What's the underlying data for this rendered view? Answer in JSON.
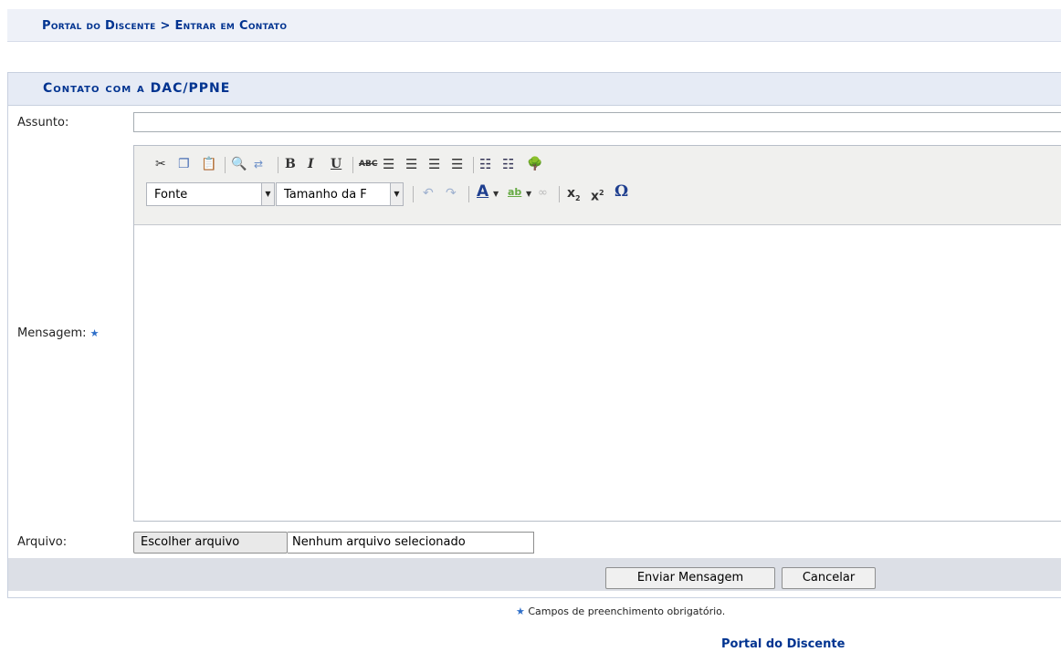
{
  "breadcrumb": "Portal do Discente > Entrar em Contato",
  "form": {
    "title": "Contato com a DAC/PPNE",
    "assunto_label": "Assunto:",
    "assunto_value": "",
    "mensagem_label": "Mensagem:",
    "arquivo_label": "Arquivo:",
    "file_button": "Escolher arquivo",
    "file_status": "Nenhum arquivo selecionado"
  },
  "editor": {
    "font_select": "Fonte",
    "size_select": "Tamanho da F",
    "toolbar_row1": [
      "cut-icon",
      "copy-icon",
      "paste-icon",
      "find-icon",
      "replace-icon",
      "bold-icon",
      "italic-icon",
      "underline-icon",
      "strikethrough-icon",
      "align-left-icon",
      "align-center-icon",
      "align-right-icon",
      "align-justify-icon",
      "bullet-list-icon",
      "numbered-list-icon",
      "image-icon"
    ],
    "toolbar_row2": [
      "undo-icon",
      "redo-icon",
      "text-color-icon",
      "highlight-color-icon",
      "link-icon",
      "subscript-icon",
      "superscript-icon",
      "special-char-icon"
    ]
  },
  "actions": {
    "send": "Enviar Mensagem",
    "cancel": "Cancelar"
  },
  "required_note": "Campos de preenchimento obrigatório.",
  "footer_link": "Portal do Discente",
  "colors": {
    "brand": "#003390",
    "required_star": "#2f6fc9",
    "header_bg": "#e6ebf5",
    "action_bar_bg": "#dcdfe6"
  }
}
